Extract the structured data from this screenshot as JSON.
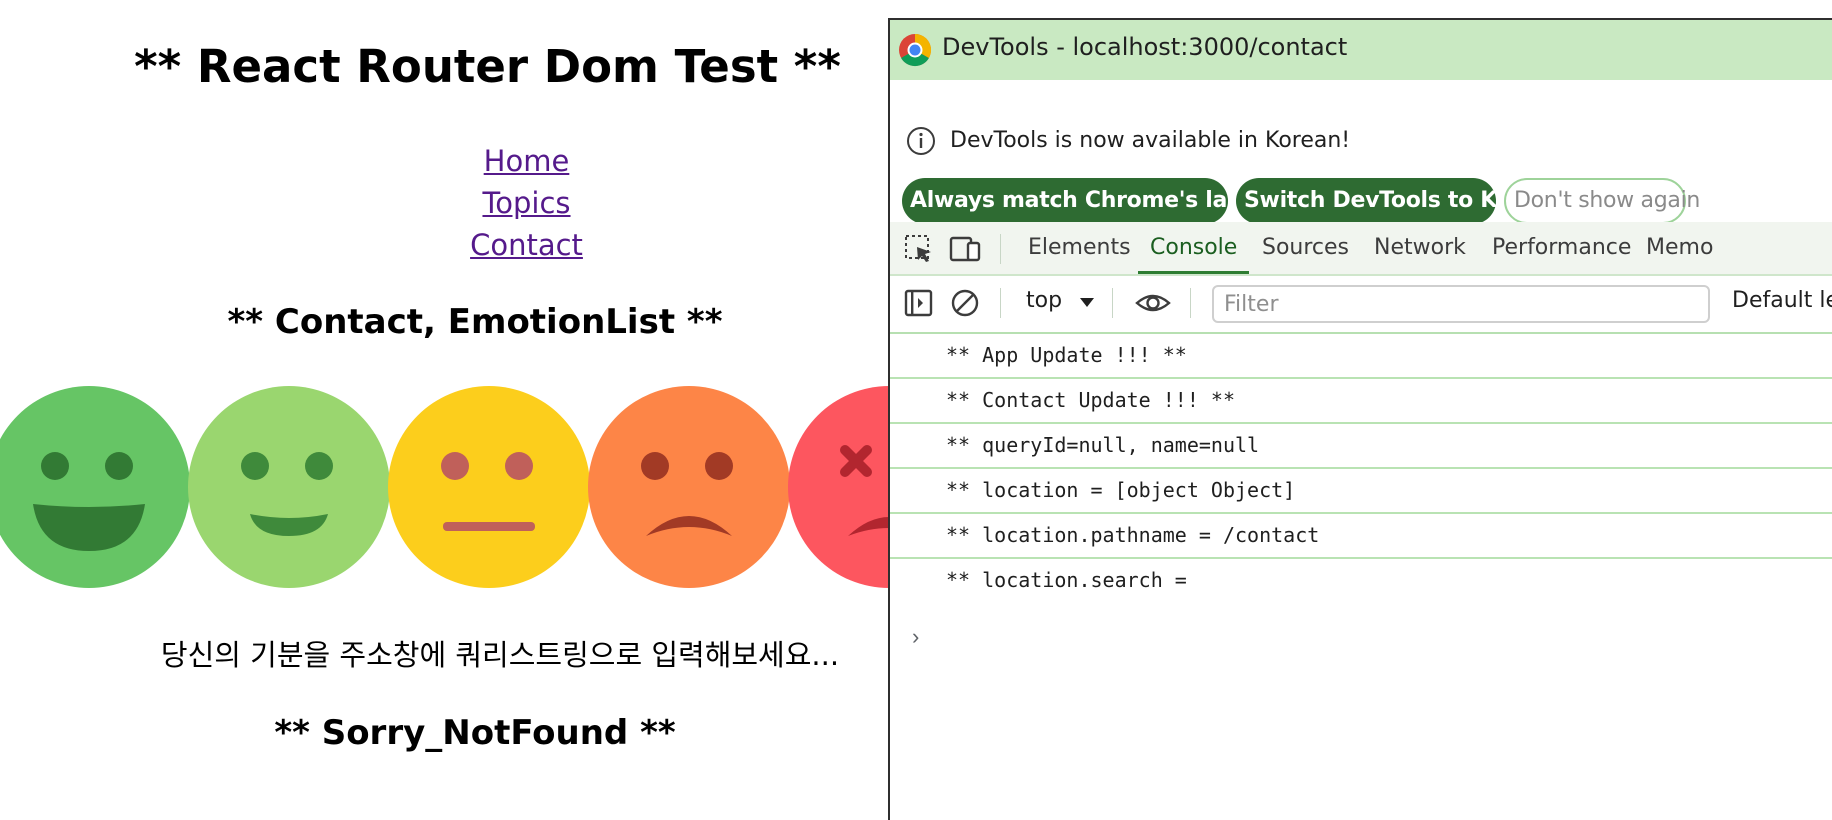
{
  "page": {
    "title": "** React Router Dom Test **",
    "nav": [
      "Home",
      "Topics",
      "Contact"
    ],
    "section_title": "** Contact, EmotionList **",
    "emotions": [
      {
        "name": "very-happy",
        "color": "#66c565"
      },
      {
        "name": "happy",
        "color": "#9ad66f"
      },
      {
        "name": "neutral",
        "color": "#fcce1c"
      },
      {
        "name": "sad",
        "color": "#fd8547"
      },
      {
        "name": "angry",
        "color": "#fd565f"
      }
    ],
    "prompt": "당신의 기분을 주소창에 쿼리스트링으로 입력해보세요...",
    "notfound_title": "** Sorry_NotFound **"
  },
  "devtools": {
    "window_title": "DevTools - localhost:3000/contact",
    "info_message": "DevTools is now available in Korean!",
    "buttons": {
      "match": "Always match Chrome's language",
      "switch": "Switch DevTools to Korean",
      "dismiss": "Don't show again"
    },
    "tabs": [
      "Elements",
      "Console",
      "Sources",
      "Network",
      "Performance",
      "Memo"
    ],
    "active_tab": "Console",
    "context": "top",
    "filter_placeholder": "Filter",
    "levels": "Default le",
    "logs": [
      "** App Update !!! **",
      "** Contact Update !!! **",
      "** queryId=null, name=null",
      "** location = [object Object]",
      "** location.pathname = /contact",
      "** location.search ="
    ],
    "prompt_symbol": "›",
    "colors": {
      "titlebar": "#c9e9c2",
      "accent": "#2e6b32"
    }
  }
}
